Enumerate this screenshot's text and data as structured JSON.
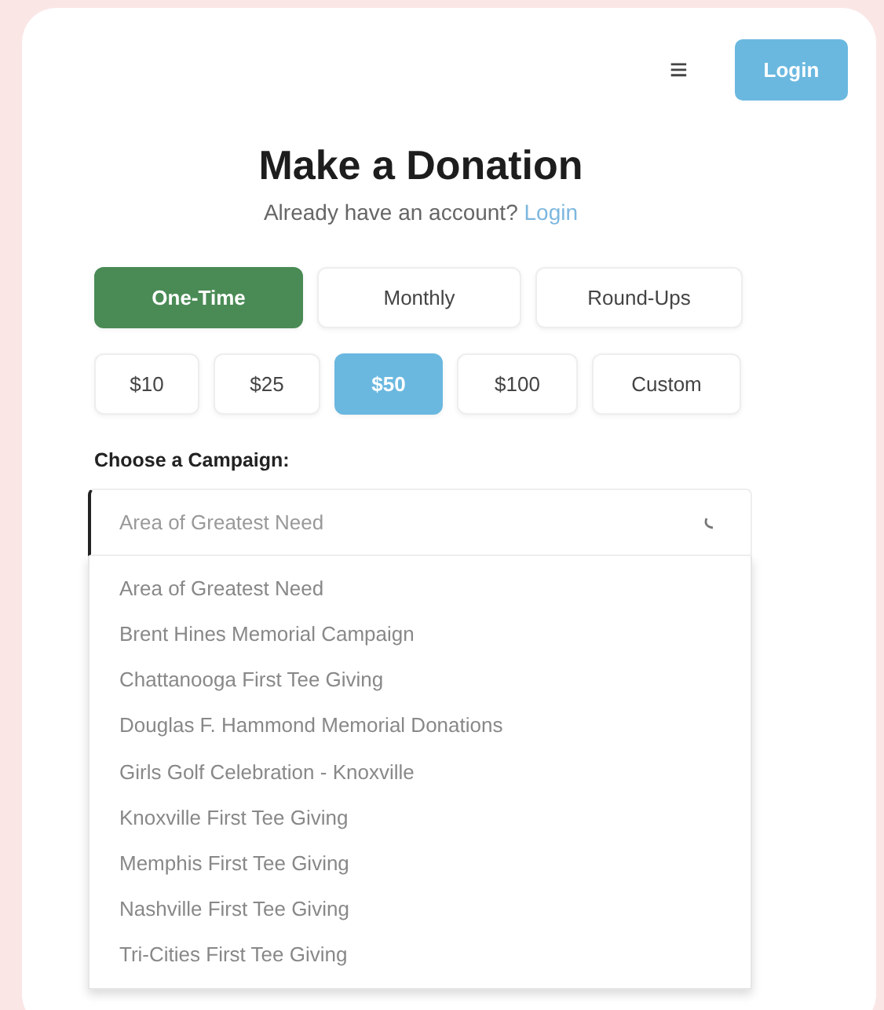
{
  "header": {
    "menu_icon": "≡",
    "login_button": "Login"
  },
  "title": "Make a Donation",
  "subtitle": {
    "text": "Already have an account?",
    "link": "Login"
  },
  "frequency_tabs": [
    {
      "label": "One-Time",
      "selected": true
    },
    {
      "label": "Monthly",
      "selected": false
    },
    {
      "label": "Round-Ups",
      "selected": false
    }
  ],
  "amounts": [
    {
      "label": "$10",
      "selected": false
    },
    {
      "label": "$25",
      "selected": false
    },
    {
      "label": "$50",
      "selected": true
    },
    {
      "label": "$100",
      "selected": false
    },
    {
      "label": "Custom",
      "selected": false
    }
  ],
  "campaign": {
    "label": "Choose a Campaign:",
    "placeholder": "Area of Greatest Need",
    "focused": true,
    "options": [
      "Area of Greatest Need",
      "Brent Hines Memorial Campaign",
      "Chattanooga First Tee Giving",
      "Douglas F. Hammond Memorial Donations",
      "Girls Golf Celebration - Knoxville",
      "Knoxville First Tee Giving",
      "Memphis First Tee Giving",
      "Nashville First Tee Giving",
      "Tri-Cities First Tee Giving"
    ]
  }
}
